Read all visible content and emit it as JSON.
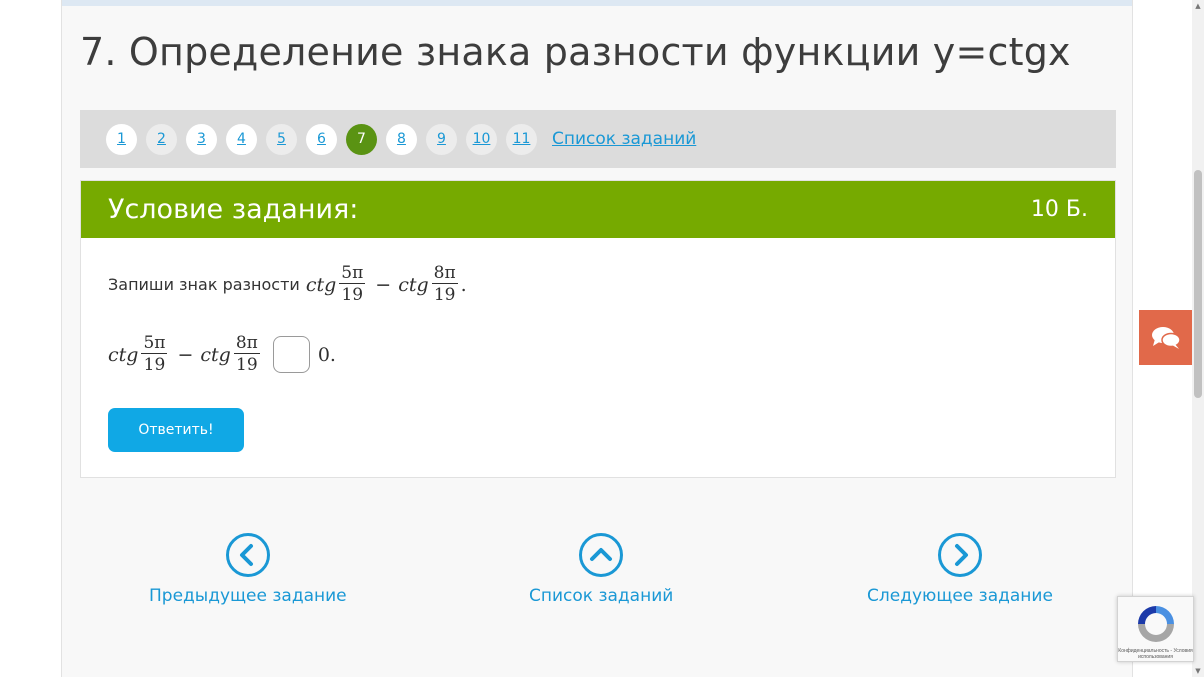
{
  "header": {
    "title": "7. Определение знака разности функции y=ctgx"
  },
  "pager": {
    "tasks": [
      {
        "label": "1",
        "state": "done"
      },
      {
        "label": "2",
        "state": "todo"
      },
      {
        "label": "3",
        "state": "done"
      },
      {
        "label": "4",
        "state": "done"
      },
      {
        "label": "5",
        "state": "todo"
      },
      {
        "label": "6",
        "state": "done"
      },
      {
        "label": "7",
        "state": "active"
      },
      {
        "label": "8",
        "state": "done"
      },
      {
        "label": "9",
        "state": "todo"
      },
      {
        "label": "10",
        "state": "todo"
      },
      {
        "label": "11",
        "state": "todo"
      }
    ],
    "list_link": "Список заданий"
  },
  "task": {
    "heading": "Условие задания:",
    "score": "10 Б.",
    "prompt_text": "Запиши знак разности",
    "expr": {
      "fn": "ctg",
      "a_num": "5π",
      "a_den": "19",
      "minus": "−",
      "b_num": "8π",
      "b_den": "19"
    },
    "period": ".",
    "answer_value": "",
    "compare_to": "0.",
    "submit_label": "Ответить!"
  },
  "nav": {
    "prev_label": "Предыдущее задание",
    "list_label": "Список заданий",
    "next_label": "Следующее задание"
  },
  "recaptcha": {
    "legal": "Конфиденциальность - Условия использования"
  },
  "colors": {
    "accent_green": "#76aa00",
    "active_page": "#5a9313",
    "link_blue": "#1a98d5",
    "submit_blue": "#10a8e5",
    "chat_orange": "#e1694a"
  },
  "icons": {
    "prev": "chevron-left-circle-icon",
    "list": "chevron-up-circle-icon",
    "next": "chevron-right-circle-icon",
    "chat": "chat-bubbles-icon",
    "recaptcha": "recaptcha-logo-icon"
  }
}
